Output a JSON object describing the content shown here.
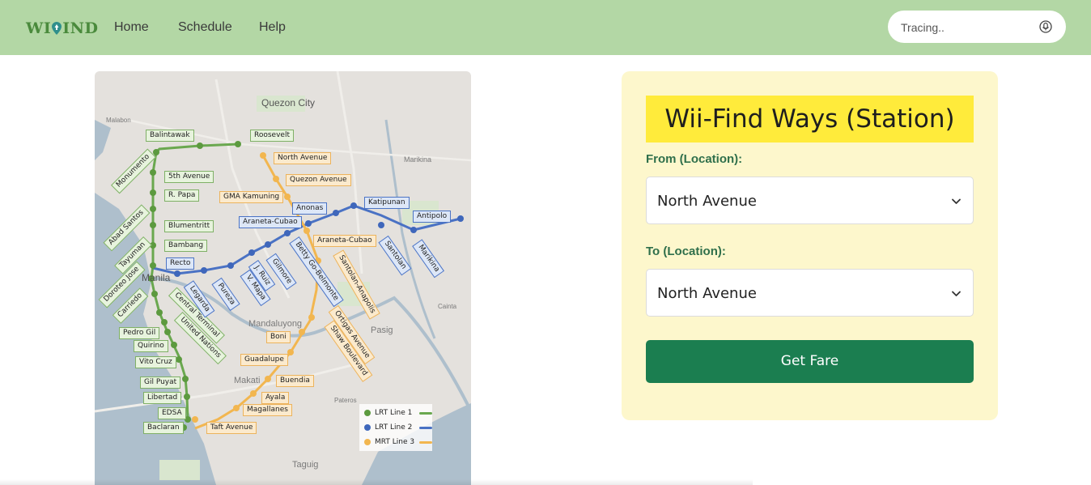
{
  "brand": {
    "logo_text_left": "WI",
    "logo_text_right": "IND",
    "logo_icon": "location-pin-icon"
  },
  "nav": {
    "items": [
      {
        "label": "Home"
      },
      {
        "label": "Schedule"
      },
      {
        "label": "Help"
      }
    ]
  },
  "search": {
    "placeholder": "Tracing..",
    "icon": "microphone-icon"
  },
  "map": {
    "places": {
      "quezon_city": "Quezon City",
      "manila": "Manila",
      "mandaluyong": "Mandaluyong",
      "makati": "Makati",
      "pasig": "Pasig",
      "taguig": "Taguig",
      "marikina": "Marikina",
      "malabon": "Malabon",
      "cainta": "Cainta",
      "pateros": "Pateros"
    },
    "lrt1_stations": [
      "Balintawak",
      "Roosevelt",
      "Monumento",
      "5th Avenue",
      "R. Papa",
      "Abad Santos",
      "Blumentritt",
      "Tayuman",
      "Bambang",
      "Doroteo Jose",
      "Carriedo",
      "Central Terminal",
      "United Nations",
      "Pedro Gil",
      "Quirino",
      "Vito Cruz",
      "Gil Puyat",
      "Libertad",
      "EDSA",
      "Baclaran"
    ],
    "lrt2_stations": [
      "Recto",
      "Legarda",
      "Pureza",
      "V. Mapa",
      "J. Ruiz",
      "Gilmore",
      "Betty Go-Belmonte",
      "Araneta-Cubao",
      "Anonas",
      "Katipunan",
      "Santolan",
      "Marikina",
      "Antipolo"
    ],
    "mrt3_stations": [
      "North Avenue",
      "Quezon Avenue",
      "GMA Kamuning",
      "Araneta-Cubao",
      "Santolan-Anapolis",
      "Ortigas Avenue",
      "Shaw Boulevard",
      "Boni",
      "Guadalupe",
      "Buendia",
      "Ayala",
      "Magallanes",
      "Taft Avenue"
    ],
    "legend": [
      {
        "label": "LRT Line 1",
        "color": "#6aa84f"
      },
      {
        "label": "LRT Line 2",
        "color": "#4a72c4"
      },
      {
        "label": "MRT Line 3",
        "color": "#f2b64f"
      }
    ]
  },
  "form": {
    "title": "Wii-Find Ways (Station)",
    "from_label": "From (Location):",
    "from_value": "North Avenue",
    "to_label": "To (Location):",
    "to_value": "North Avenue",
    "submit_label": "Get Fare"
  },
  "colors": {
    "nav_bg": "#b3d7a5",
    "card_bg": "#fdf7cc",
    "title_bg": "#ffeb3b",
    "button_bg": "#1b7e50",
    "label_color": "#2f6f4b"
  }
}
